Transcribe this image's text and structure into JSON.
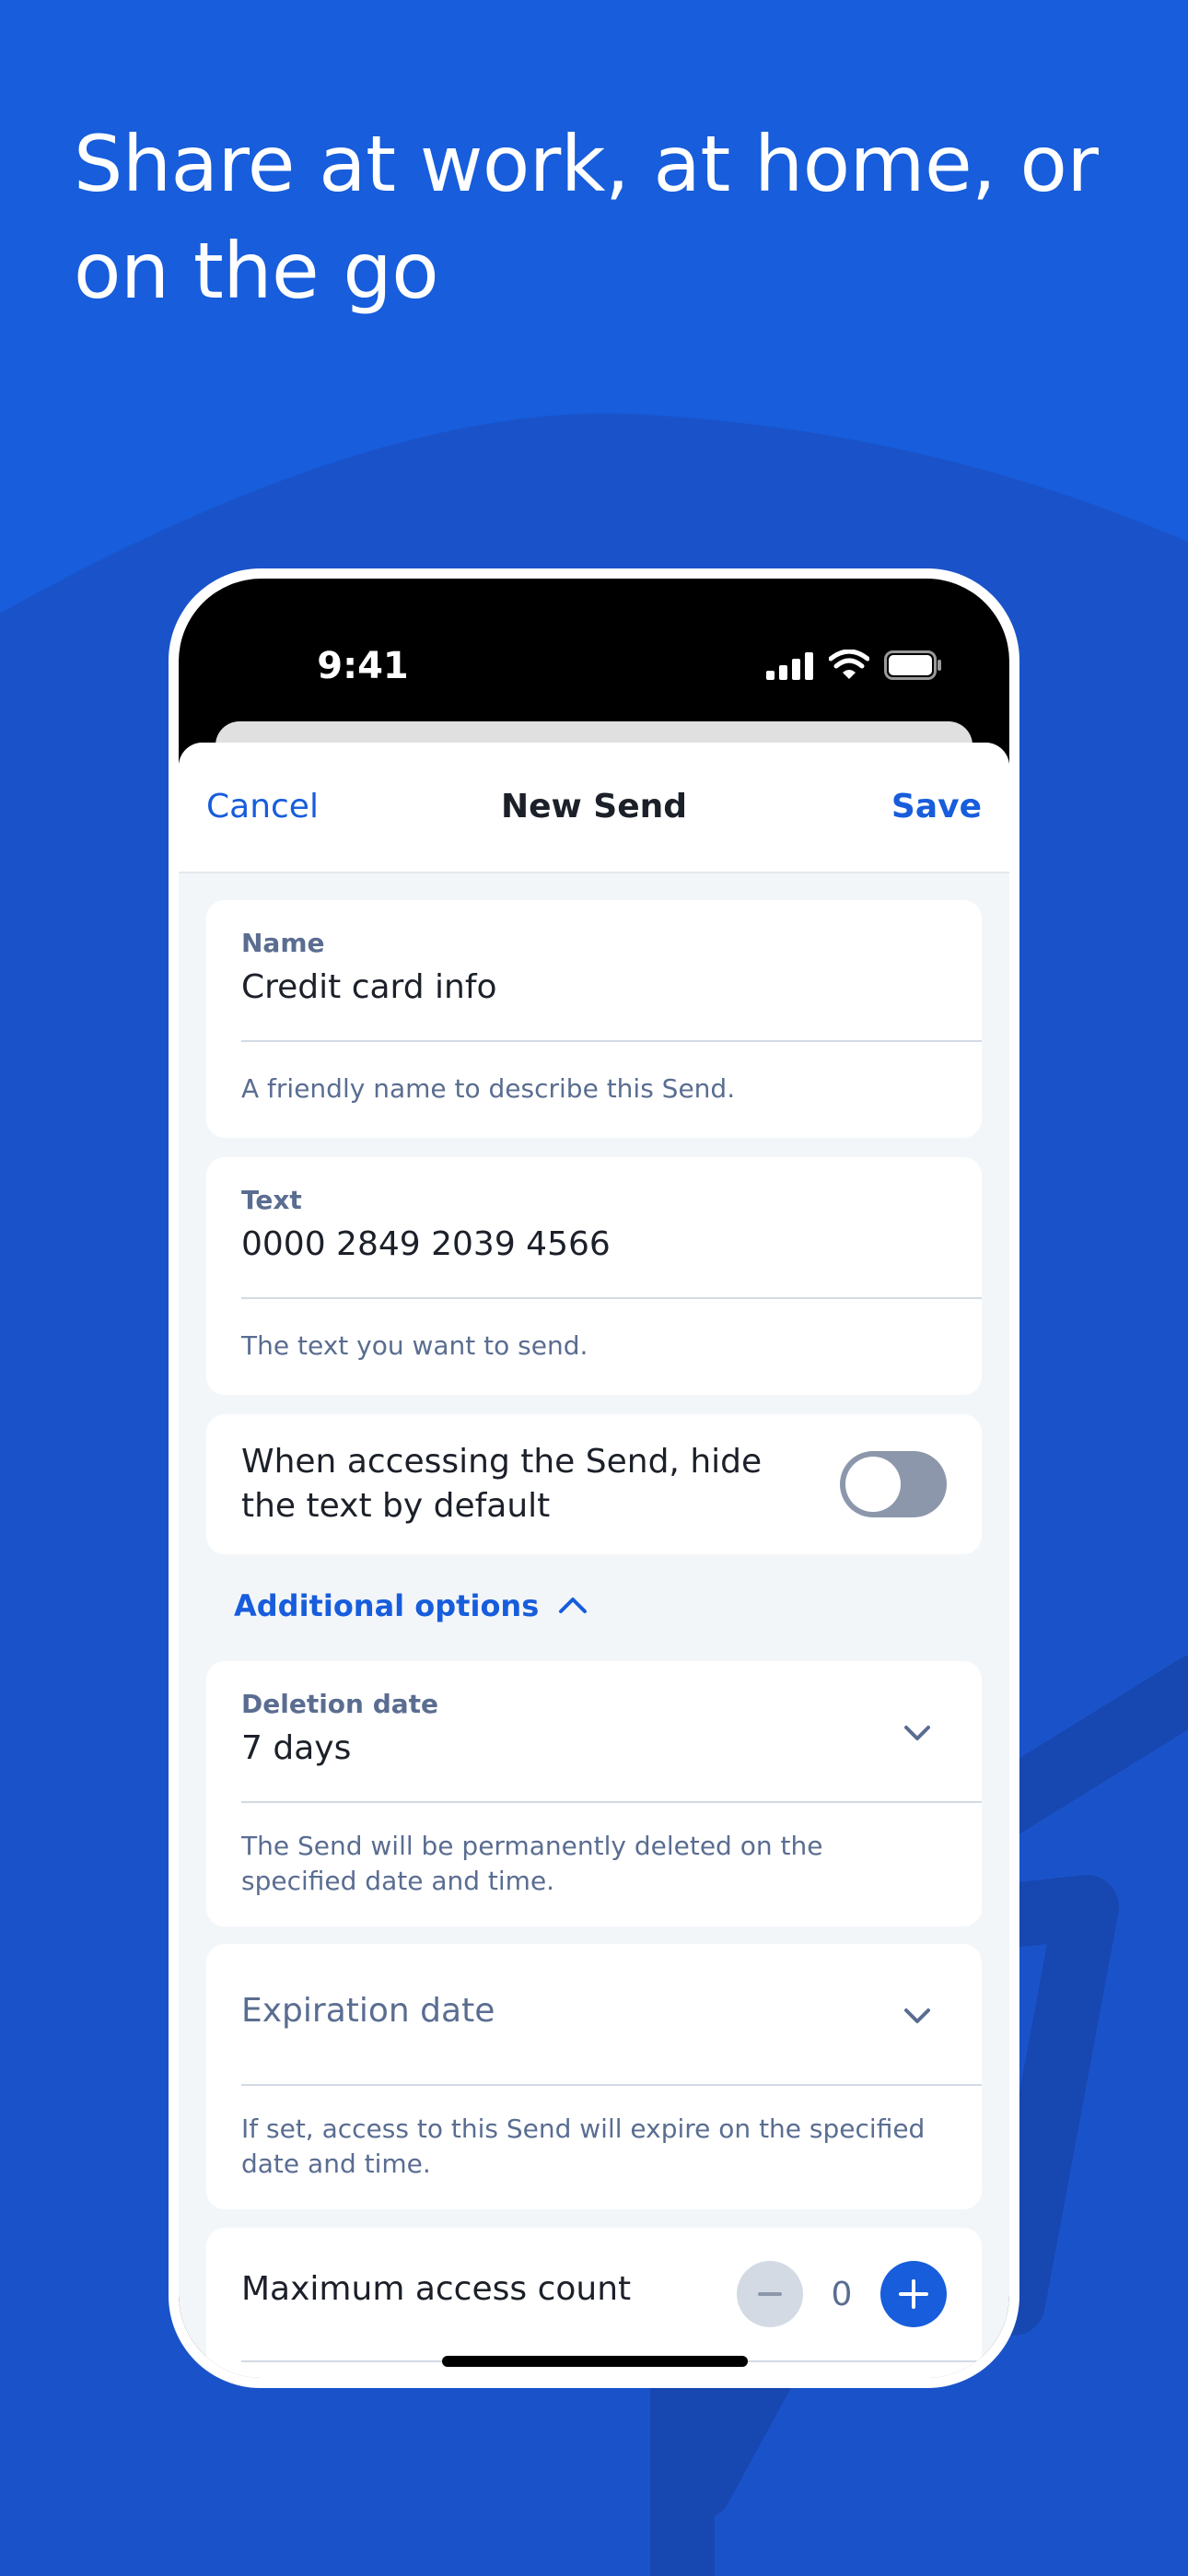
{
  "headline": "Share at work, at home, or on the go",
  "colors": {
    "brand": "#175DDC",
    "text": "#1B2029",
    "muted": "#5A6D91",
    "toggle_off": "#8C97AB"
  },
  "status_bar": {
    "time": "9:41",
    "icons": [
      "signal-icon",
      "wifi-icon",
      "battery-icon"
    ]
  },
  "nav": {
    "cancel": "Cancel",
    "title": "New Send",
    "save": "Save"
  },
  "name_field": {
    "label": "Name",
    "value": "Credit card info",
    "helper": "A friendly name to describe this Send."
  },
  "text_field": {
    "label": "Text",
    "value": "0000 2849 2039 4566",
    "helper": "The text you want to send."
  },
  "hide_toggle": {
    "label": "When accessing the Send, hide the text by default",
    "on": false
  },
  "additional_options": {
    "label": "Additional options",
    "expanded": true
  },
  "deletion_date": {
    "label": "Deletion date",
    "value": "7 days",
    "helper": "The Send will be permanently deleted on the specified date and time."
  },
  "expiration_date": {
    "placeholder": "Expiration date",
    "helper": "If set, access to this Send will expire on the specified date and time."
  },
  "max_access": {
    "label": "Maximum access count",
    "value": "0"
  }
}
